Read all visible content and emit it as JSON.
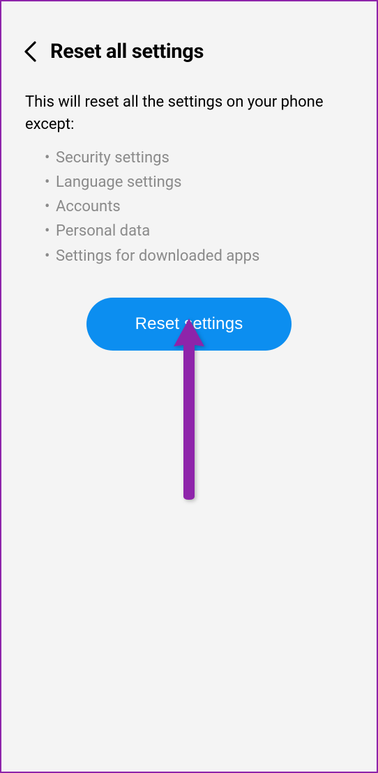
{
  "header": {
    "title": "Reset all settings"
  },
  "description": "This will reset all the settings on your phone except:",
  "exceptions": [
    "Security settings",
    "Language settings",
    "Accounts",
    "Personal data",
    "Settings for downloaded apps"
  ],
  "button": {
    "label": "Reset settings"
  },
  "annotation": {
    "arrow_color": "#8e24aa"
  }
}
